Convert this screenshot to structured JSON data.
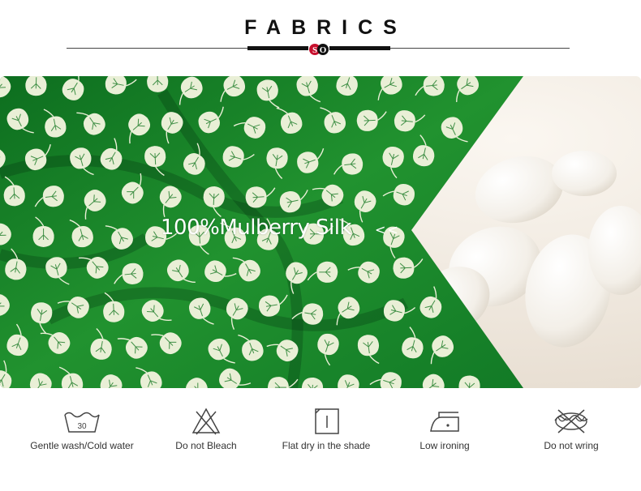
{
  "header": {
    "title": "FABRICS",
    "logo_text": "SO"
  },
  "banner": {
    "headline": "100%Mulberry Silk",
    "arrows": "<<",
    "fabric_color": "#1e8a2c",
    "leaf_color": "#e9efd6",
    "cocoon_color": "#f6f2ec"
  },
  "care": {
    "items": [
      {
        "icon": "wash-30-icon",
        "label": "Gentle wash/Cold water",
        "temp": "30"
      },
      {
        "icon": "no-bleach-icon",
        "label": "Do not Bleach"
      },
      {
        "icon": "flat-dry-shade-icon",
        "label": "Flat dry in the shade"
      },
      {
        "icon": "low-iron-icon",
        "label": "Low ironing"
      },
      {
        "icon": "no-wring-icon",
        "label": "Do not wring"
      }
    ]
  }
}
